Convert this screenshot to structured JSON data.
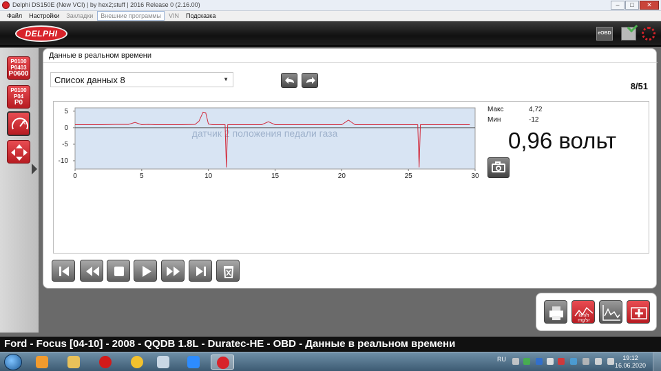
{
  "window": {
    "title": "Delphi DS150E (New VCI) | by hex2;stuff | 2016 Release 0 (2.16.00)"
  },
  "menu": [
    {
      "label": "Файл"
    },
    {
      "label": "Настройки"
    },
    {
      "label": "Закладки"
    },
    {
      "label": "Внешние программы"
    },
    {
      "label": "VIN"
    },
    {
      "label": "Подсказка"
    }
  ],
  "header": {
    "logo": "DELPHI",
    "eobd_label": "eOBD"
  },
  "sidebar": {
    "dtc1_codes": [
      "P0100",
      "P0403",
      "P0600"
    ],
    "dtc2_codes": [
      "P0100",
      "P04",
      "P0"
    ]
  },
  "main": {
    "tab_title": "Данные в реальном времени",
    "list_selected": "Список данных 8",
    "page_counter": "8/51"
  },
  "chart_data": {
    "type": "line",
    "title": "датчик 2 положения педали газа",
    "xlim": [
      0,
      30
    ],
    "ylim": [
      -12.5,
      6
    ],
    "x_ticks": [
      0,
      5,
      10,
      15,
      20,
      25,
      30
    ],
    "y_ticks": [
      5,
      0,
      -5,
      -10
    ],
    "grid": false,
    "series": [
      {
        "color": "#d2293a",
        "x": [
          0,
          1,
          2,
          3,
          4,
          4.5,
          5,
          5.5,
          6,
          7,
          8,
          9,
          9.3,
          9.6,
          9.8,
          10,
          10.3,
          11,
          11.25,
          11.35,
          11.45,
          11.6,
          12,
          13,
          14,
          14.5,
          15,
          15.5,
          16,
          17,
          18,
          19,
          20,
          20.5,
          21,
          22,
          23,
          24,
          25,
          25.7,
          25.8,
          25.9,
          26.2,
          27,
          28,
          29,
          29.6
        ],
        "values": [
          0.9,
          0.9,
          0.9,
          1.0,
          1.0,
          1.6,
          0.9,
          1.0,
          0.9,
          0.9,
          0.9,
          1.0,
          2.0,
          4.7,
          4.5,
          1.1,
          0.9,
          0.9,
          0.9,
          -12.0,
          0.9,
          0.9,
          0.9,
          0.9,
          0.9,
          1.8,
          0.9,
          0.9,
          0.9,
          0.9,
          0.9,
          0.9,
          0.9,
          2.3,
          0.9,
          0.9,
          0.9,
          0.9,
          0.9,
          0.9,
          -12.0,
          0.9,
          0.9,
          0.9,
          0.9,
          0.9,
          0.9
        ]
      }
    ]
  },
  "readout": {
    "max_label": "Макс",
    "max_value": "4,72",
    "min_label": "Мин",
    "min_value": "-12",
    "value": "0,96 вольт"
  },
  "bottom_tools": {
    "units_label": "km/h\nmg/sr"
  },
  "status": {
    "vehicle": "Ford - Focus [04-10] - 2008 - QQDB 1.8L - Duratec-HE - OBD - Данные в реальном времени"
  },
  "taskbar": {
    "lang": "RU",
    "time": "19:12",
    "date": "16.06.2020"
  },
  "colors": {
    "brand_red": "#d8232a",
    "chart_fill": "#d8e4f3",
    "trace": "#d2293a"
  }
}
